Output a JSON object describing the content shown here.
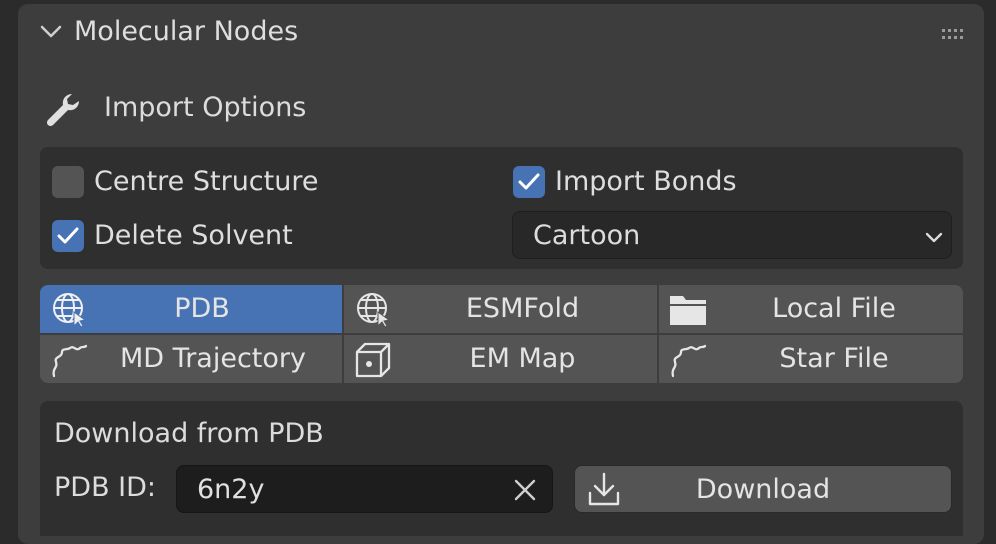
{
  "panel": {
    "title": "Molecular Nodes",
    "section_title": "Import Options"
  },
  "options": {
    "centre_structure": {
      "label": "Centre Structure",
      "checked": false
    },
    "delete_solvent": {
      "label": "Delete Solvent",
      "checked": true
    },
    "import_bonds": {
      "label": "Import Bonds",
      "checked": true
    },
    "style": {
      "value": "Cartoon"
    }
  },
  "tabs": [
    {
      "label": "PDB",
      "icon": "globe-cursor-icon",
      "active": true
    },
    {
      "label": "ESMFold",
      "icon": "globe-cursor-icon",
      "active": false
    },
    {
      "label": "Local File",
      "icon": "folder-icon",
      "active": false
    },
    {
      "label": "MD Trajectory",
      "icon": "squiggle-curve-icon",
      "active": false
    },
    {
      "label": "EM Map",
      "icon": "cube-icon",
      "active": false
    },
    {
      "label": "Star File",
      "icon": "squiggle-curve-icon",
      "active": false
    }
  ],
  "download": {
    "title": "Download from PDB",
    "id_label": "PDB ID:",
    "id_value": "6n2y",
    "button_label": "Download"
  },
  "colors": {
    "accent": "#4772b3",
    "panel": "#3d3d3d",
    "box": "#2f2f2f",
    "button": "#545454"
  }
}
